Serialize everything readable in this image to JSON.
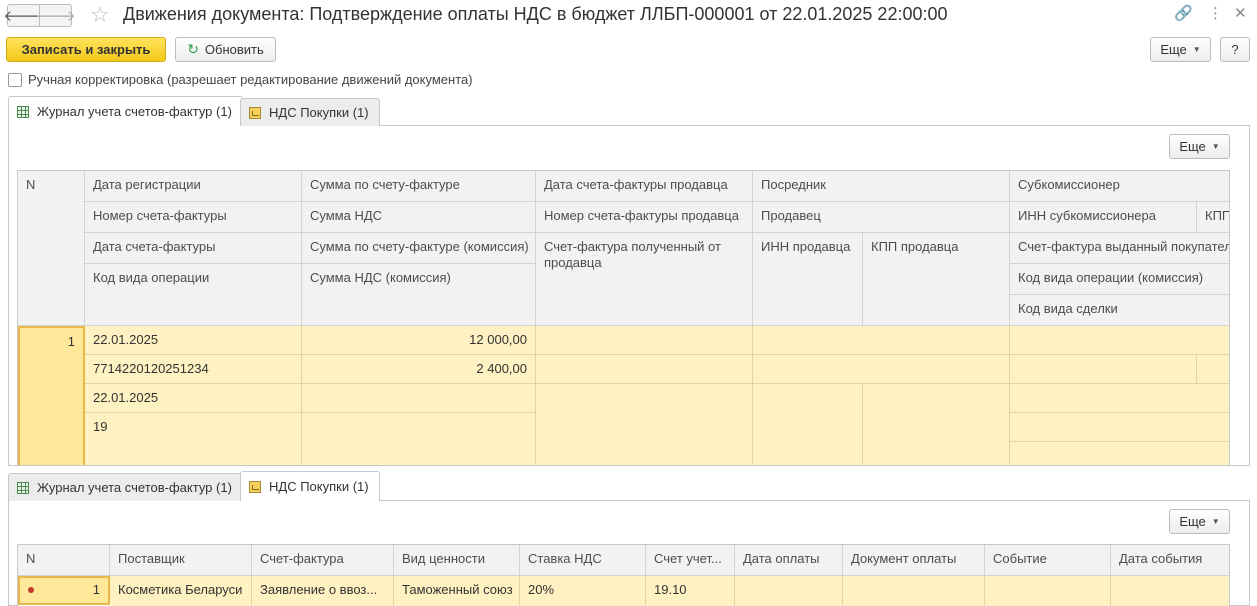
{
  "window": {
    "title": "Движения документа: Подтверждение оплаты НДС в бюджет ЛЛБП-000001 от 22.01.2025 22:00:00",
    "back_glyph": "🡐",
    "forward_glyph": "🡒",
    "star_glyph": "☆",
    "link_glyph": "🔗",
    "menu_glyph": "⋮",
    "close_glyph": "✕"
  },
  "toolbar": {
    "save_close": "Записать и закрыть",
    "refresh": "Обновить",
    "refresh_glyph": "↻",
    "more": "Еще",
    "help": "?"
  },
  "manual_edit": {
    "label": "Ручная корректировка (разрешает редактирование движений документа)",
    "checked": false
  },
  "tabs": [
    {
      "label": "Журнал учета счетов-фактур (1)",
      "icon": "grid-icon"
    },
    {
      "label": "НДС Покупки (1)",
      "icon": "register-icon"
    }
  ],
  "journal": {
    "more": "Еще",
    "headers": {
      "n": "N",
      "reg_date": "Дата регистрации",
      "invoice_number": "Номер счета-фактуры",
      "invoice_date": "Дата счета-фактуры",
      "op_code": "Код вида операции",
      "invoice_sum": "Сумма по счету-фактуре",
      "vat_sum": "Сумма НДС",
      "invoice_sum_comm": "Сумма по счету-фактуре (комиссия)",
      "vat_sum_comm": "Сумма НДС (комиссия)",
      "seller_invoice_date": "Дата счета-фактуры продавца",
      "seller_invoice_number": "Номер счета-фактуры продавца",
      "invoice_received": "Счет-фактура полученный от продавца",
      "intermediary": "Посредник",
      "seller": "Продавец",
      "seller_inn": "ИНН продавца",
      "seller_kpp": "КПП продавца",
      "subcommissioner": "Субкомиссионер",
      "subcomm_inn": "ИНН субкомиссионера",
      "subcomm_kpp": "КПП",
      "invoice_issued": "Счет-фактура выданный покупателю",
      "op_code_comm": "Код вида операции (комиссия)",
      "deal_code": "Код вида сделки"
    },
    "row": {
      "n": "1",
      "reg_date": "22.01.2025",
      "invoice_number": "7714220120251234",
      "invoice_date": "22.01.2025",
      "op_code": "19",
      "invoice_sum": "12 000,00",
      "vat_sum": "2 400,00"
    }
  },
  "purchases": {
    "more": "Еще",
    "headers": [
      "N",
      "Поставщик",
      "Счет-фактура",
      "Вид ценности",
      "Ставка НДС",
      "Счет учет...",
      "Дата оплаты",
      "Документ оплаты",
      "Событие",
      "Дата события"
    ],
    "row": {
      "n": "1",
      "supplier": "Косметика Беларуси",
      "invoice": "Заявление о ввоз...",
      "value_type": "Таможенный союз",
      "vat_rate": "20%",
      "account": "19.10",
      "pay_date": "",
      "pay_doc": "",
      "event": "",
      "event_date": ""
    }
  }
}
